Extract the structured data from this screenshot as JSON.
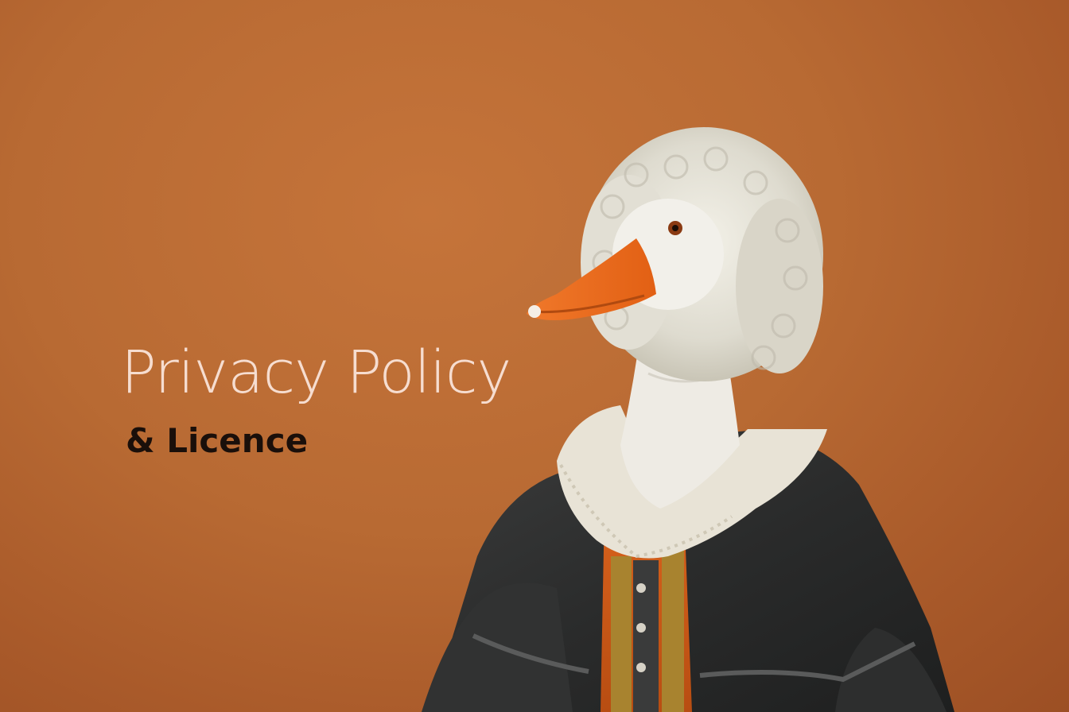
{
  "hero": {
    "title": "Privacy Policy",
    "subtitle": "& Licence"
  },
  "image": {
    "subject": "goose-in-wig-and-robe",
    "background_color": "#b86a33",
    "title_color": "#f6ddd0",
    "subtitle_color": "#1a0f0a"
  }
}
